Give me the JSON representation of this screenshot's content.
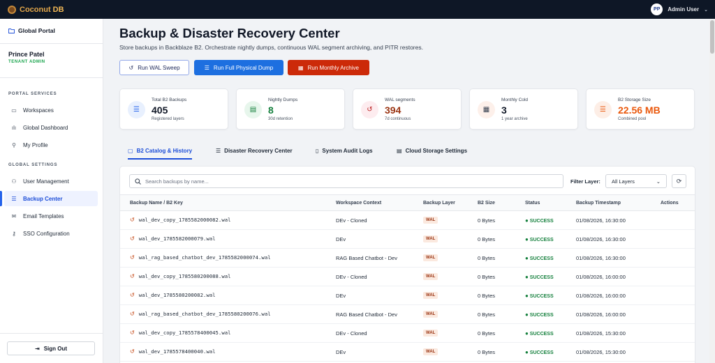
{
  "app": {
    "brand_name": "Coconut",
    "brand_suffix": "DB",
    "user_initials": "PP",
    "user_label": "Admin User",
    "user_caret": "⌄"
  },
  "sidebar": {
    "portal_label": "Global Portal",
    "tenant_name": "Prince Patel",
    "tenant_role": "TENANT ADMIN",
    "section_services": "PORTAL SERVICES",
    "section_settings": "GLOBAL SETTINGS",
    "items": [
      {
        "label": "Workspaces",
        "icon": "folder-icon"
      },
      {
        "label": "Global Dashboard",
        "icon": "bar-chart-icon"
      },
      {
        "label": "My Profile",
        "icon": "user-icon"
      },
      {
        "label": "User Management",
        "icon": "users-icon"
      },
      {
        "label": "Backup Center",
        "icon": "database-icon"
      },
      {
        "label": "Email Templates",
        "icon": "mail-icon"
      },
      {
        "label": "SSO Configuration",
        "icon": "key-icon"
      }
    ],
    "sign_out": "Sign Out"
  },
  "page": {
    "title": "Backup & Disaster Recovery Center",
    "subtitle": "Store backups in Backblaze B2. Orchestrate nightly dumps, continuous WAL segment archiving, and PITR restores."
  },
  "actions": {
    "wal_sweep": "Run WAL Sweep",
    "full_dump": "Run Full Physical Dump",
    "monthly_archive": "Run Monthly Archive"
  },
  "stats": [
    {
      "label": "Total B2 Backups",
      "value": "405",
      "sub": "Registered layers",
      "color": "#111827",
      "icon_bg": "#e8f0fe",
      "icon_color": "#2563eb"
    },
    {
      "label": "Nightly Dumps",
      "value": "8",
      "sub": "30d retention",
      "color": "#15803d",
      "icon_bg": "#e7f6ec",
      "icon_color": "#15803d"
    },
    {
      "label": "WAL segments",
      "value": "394",
      "sub": "7d continuous",
      "color": "#9a3412",
      "icon_bg": "#fdecef",
      "icon_color": "#b91c1c"
    },
    {
      "label": "Monthly Cold",
      "value": "3",
      "sub": "1 year archive",
      "color": "#111827",
      "icon_bg": "#fdf0ea",
      "icon_color": "#374151"
    },
    {
      "label": "B2 Storage Size",
      "value": "22.56 MB",
      "sub": "Combined pool",
      "color": "#ea580c",
      "icon_bg": "#fdeee6",
      "icon_color": "#ea580c"
    }
  ],
  "tabs": [
    {
      "label": "B2 Catalog & History",
      "icon": "book-icon"
    },
    {
      "label": "Disaster Recovery Center",
      "icon": "database-icon"
    },
    {
      "label": "System Audit Logs",
      "icon": "file-icon"
    },
    {
      "label": "Cloud Storage Settings",
      "icon": "server-icon"
    }
  ],
  "table": {
    "search_placeholder": "Search backups by name...",
    "filter_label": "Filter Layer:",
    "filter_value": "All Layers",
    "columns": [
      "Backup Name / B2 Key",
      "Workspace Context",
      "Backup Layer",
      "B2 Size",
      "Status",
      "Backup Timestamp",
      "Actions"
    ],
    "rows": [
      {
        "name": "wal_dev_copy_1785582000082.wal",
        "workspace": "DEv - Cloned",
        "layer": "WAL",
        "size": "0 Bytes",
        "status": "SUCCESS",
        "timestamp": "01/08/2026, 16:30:00"
      },
      {
        "name": "wal_dev_1785582000079.wal",
        "workspace": "DEv",
        "layer": "WAL",
        "size": "0 Bytes",
        "status": "SUCCESS",
        "timestamp": "01/08/2026, 16:30:00"
      },
      {
        "name": "wal_rag_based_chatbot_dev_1785582000074.wal",
        "workspace": "RAG Based Chatbot - Dev",
        "layer": "WAL",
        "size": "0 Bytes",
        "status": "SUCCESS",
        "timestamp": "01/08/2026, 16:30:00"
      },
      {
        "name": "wal_dev_copy_1785580200088.wal",
        "workspace": "DEv - Cloned",
        "layer": "WAL",
        "size": "0 Bytes",
        "status": "SUCCESS",
        "timestamp": "01/08/2026, 16:00:00"
      },
      {
        "name": "wal_dev_1785580200082.wal",
        "workspace": "DEv",
        "layer": "WAL",
        "size": "0 Bytes",
        "status": "SUCCESS",
        "timestamp": "01/08/2026, 16:00:00"
      },
      {
        "name": "wal_rag_based_chatbot_dev_1785580200076.wal",
        "workspace": "RAG Based Chatbot - Dev",
        "layer": "WAL",
        "size": "0 Bytes",
        "status": "SUCCESS",
        "timestamp": "01/08/2026, 16:00:00"
      },
      {
        "name": "wal_dev_copy_1785578400045.wal",
        "workspace": "DEv - Cloned",
        "layer": "WAL",
        "size": "0 Bytes",
        "status": "SUCCESS",
        "timestamp": "01/08/2026, 15:30:00"
      },
      {
        "name": "wal_dev_1785578400040.wal",
        "workspace": "DEv",
        "layer": "WAL",
        "size": "0 Bytes",
        "status": "SUCCESS",
        "timestamp": "01/08/2026, 15:30:00"
      }
    ]
  }
}
